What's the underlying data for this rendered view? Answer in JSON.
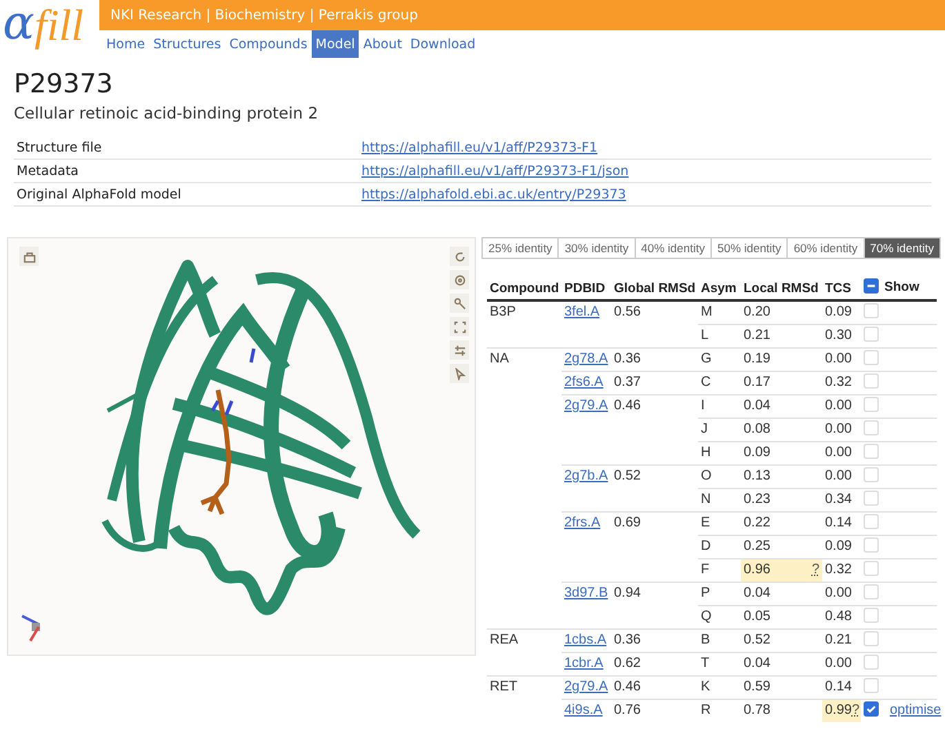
{
  "logo": {
    "alpha": "α",
    "word": "fill"
  },
  "header": {
    "text": "NKI Research | Biochemistry | Perrakis group"
  },
  "nav": [
    {
      "label": "Home",
      "selected": false
    },
    {
      "label": "Structures",
      "selected": false
    },
    {
      "label": "Compounds",
      "selected": false
    },
    {
      "label": "Model",
      "selected": true
    },
    {
      "label": "About",
      "selected": false
    },
    {
      "label": "Download",
      "selected": false
    }
  ],
  "title": "P29373",
  "subtitle": "Cellular retinoic acid-binding protein 2",
  "info": [
    {
      "label": "Structure file",
      "link": "https://alphafill.eu/v1/aff/P29373-F1"
    },
    {
      "label": "Metadata",
      "link": "https://alphafill.eu/v1/aff/P29373-F1/json"
    },
    {
      "label": "Original AlphaFold model",
      "link": "https://alphafold.ebi.ac.uk/entry/P29373"
    }
  ],
  "identity_tabs": [
    {
      "label": "25% identity",
      "selected": false
    },
    {
      "label": "30% identity",
      "selected": false
    },
    {
      "label": "40% identity",
      "selected": false
    },
    {
      "label": "50% identity",
      "selected": false
    },
    {
      "label": "60% identity",
      "selected": false
    },
    {
      "label": "70% identity",
      "selected": true
    }
  ],
  "table": {
    "columns": [
      "Compound",
      "PDBID",
      "Global RMSd",
      "Asym",
      "Local RMSd",
      "TCS",
      "Show"
    ],
    "show_all_indeterminate": true,
    "compounds": [
      {
        "name": "B3P",
        "hits": [
          {
            "pdbid": "3fel.A",
            "global_rmsd": "0.56",
            "chains": [
              {
                "asym": "M",
                "local_rmsd": "0.20",
                "tcs": "0.09",
                "checked": false
              },
              {
                "asym": "L",
                "local_rmsd": "0.21",
                "tcs": "0.30",
                "checked": false
              }
            ]
          }
        ]
      },
      {
        "name": "NA",
        "hits": [
          {
            "pdbid": "2g78.A",
            "global_rmsd": "0.36",
            "chains": [
              {
                "asym": "G",
                "local_rmsd": "0.19",
                "tcs": "0.00",
                "checked": false
              }
            ]
          },
          {
            "pdbid": "2fs6.A",
            "global_rmsd": "0.37",
            "chains": [
              {
                "asym": "C",
                "local_rmsd": "0.17",
                "tcs": "0.32",
                "checked": false
              }
            ]
          },
          {
            "pdbid": "2g79.A",
            "global_rmsd": "0.46",
            "chains": [
              {
                "asym": "I",
                "local_rmsd": "0.04",
                "tcs": "0.00",
                "checked": false
              },
              {
                "asym": "J",
                "local_rmsd": "0.08",
                "tcs": "0.00",
                "checked": false
              },
              {
                "asym": "H",
                "local_rmsd": "0.09",
                "tcs": "0.00",
                "checked": false
              }
            ]
          },
          {
            "pdbid": "2g7b.A",
            "global_rmsd": "0.52",
            "chains": [
              {
                "asym": "O",
                "local_rmsd": "0.13",
                "tcs": "0.00",
                "checked": false
              },
              {
                "asym": "N",
                "local_rmsd": "0.23",
                "tcs": "0.34",
                "checked": false
              }
            ]
          },
          {
            "pdbid": "2frs.A",
            "global_rmsd": "0.69",
            "chains": [
              {
                "asym": "E",
                "local_rmsd": "0.22",
                "tcs": "0.14",
                "checked": false
              },
              {
                "asym": "D",
                "local_rmsd": "0.25",
                "tcs": "0.09",
                "checked": false
              },
              {
                "asym": "F",
                "local_rmsd": "0.96",
                "local_rmsd_flag": "?",
                "tcs": "0.32",
                "checked": false
              }
            ]
          },
          {
            "pdbid": "3d97.B",
            "global_rmsd": "0.94",
            "chains": [
              {
                "asym": "P",
                "local_rmsd": "0.04",
                "tcs": "0.00",
                "checked": false
              },
              {
                "asym": "Q",
                "local_rmsd": "0.05",
                "tcs": "0.48",
                "checked": false
              }
            ]
          }
        ]
      },
      {
        "name": "REA",
        "hits": [
          {
            "pdbid": "1cbs.A",
            "global_rmsd": "0.36",
            "chains": [
              {
                "asym": "B",
                "local_rmsd": "0.52",
                "tcs": "0.21",
                "checked": false
              }
            ]
          },
          {
            "pdbid": "1cbr.A",
            "global_rmsd": "0.62",
            "chains": [
              {
                "asym": "T",
                "local_rmsd": "0.04",
                "tcs": "0.00",
                "checked": false
              }
            ]
          }
        ]
      },
      {
        "name": "RET",
        "hits": [
          {
            "pdbid": "2g79.A",
            "global_rmsd": "0.46",
            "chains": [
              {
                "asym": "K",
                "local_rmsd": "0.59",
                "tcs": "0.14",
                "checked": false
              }
            ]
          },
          {
            "pdbid": "4i9s.A",
            "global_rmsd": "0.76",
            "chains": [
              {
                "asym": "R",
                "local_rmsd": "0.78",
                "tcs": "0.99",
                "tcs_flag": "?",
                "checked": true,
                "action": "optimise"
              }
            ]
          }
        ]
      }
    ]
  }
}
